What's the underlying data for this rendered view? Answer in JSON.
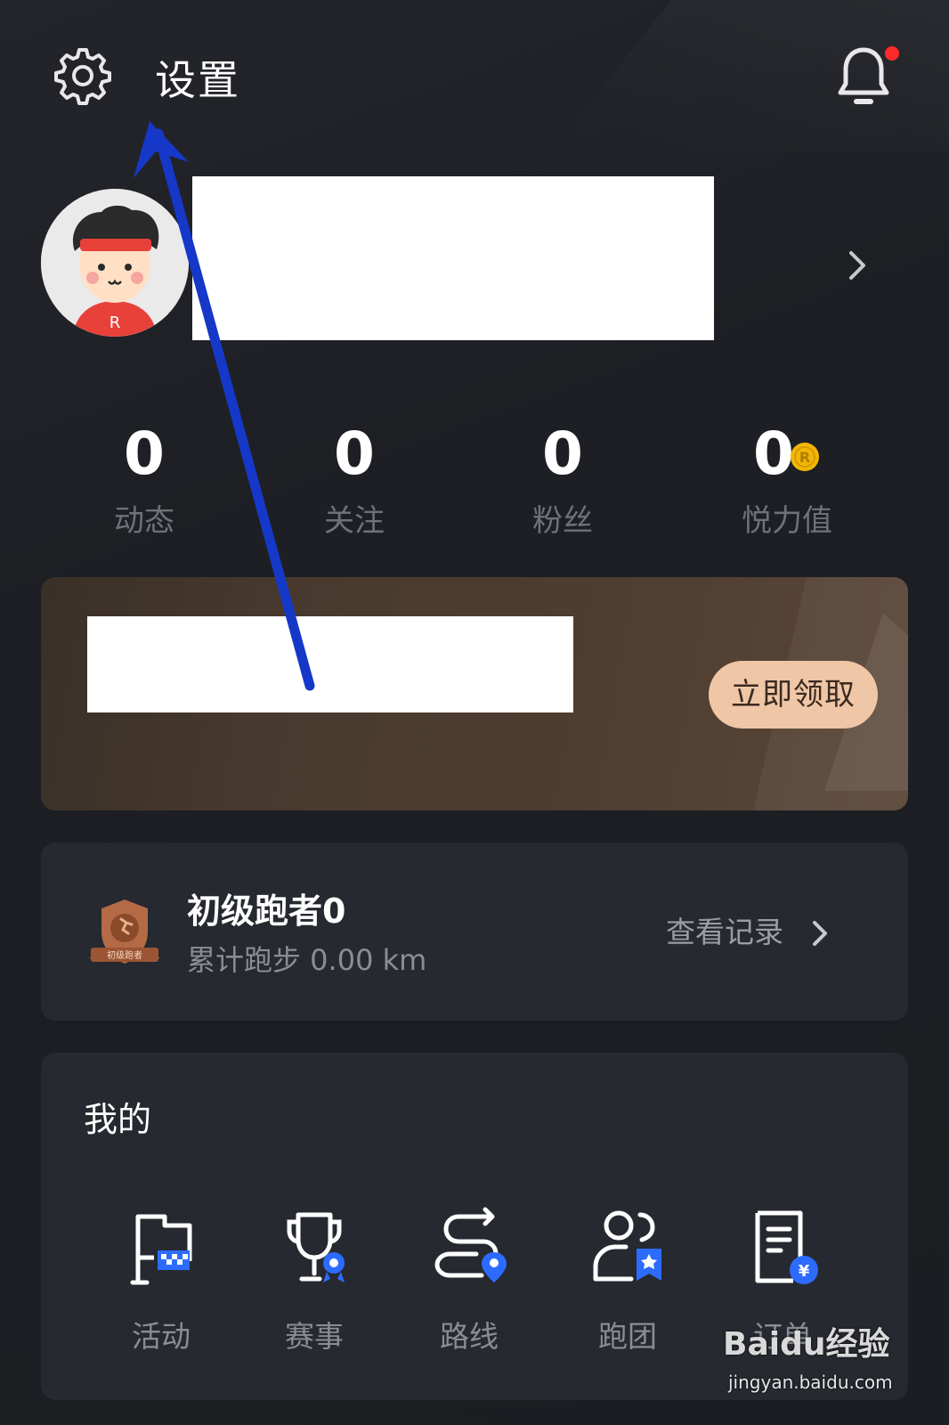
{
  "header": {
    "title": "设置",
    "has_notification": true
  },
  "profile": {
    "name_redacted": true
  },
  "stats": [
    {
      "value": "0",
      "label": "动态"
    },
    {
      "value": "0",
      "label": "关注"
    },
    {
      "value": "0",
      "label": "粉丝"
    },
    {
      "value": "0",
      "label": "悦力值"
    }
  ],
  "promo": {
    "button_label": "立即领取"
  },
  "runner": {
    "title": "初级跑者0",
    "distance_text": "累计跑步 0.00 km",
    "view_records_label": "查看记录",
    "medal_text": "初级跑者"
  },
  "mine": {
    "title": "我的",
    "items": [
      {
        "label": "活动",
        "icon": "activity-flag-icon"
      },
      {
        "label": "赛事",
        "icon": "trophy-icon"
      },
      {
        "label": "路线",
        "icon": "route-icon"
      },
      {
        "label": "跑团",
        "icon": "run-group-icon"
      },
      {
        "label": "订单",
        "icon": "order-icon"
      }
    ]
  },
  "colors": {
    "background": "#1c1e23",
    "card": "#262930",
    "accent_blue": "#2d6bff",
    "claim_button": "#efc6a6",
    "notification_dot": "#ff2a2a",
    "annotation_arrow": "#1538c8"
  },
  "watermark": {
    "brand": "Baidu经验",
    "url": "jingyan.baidu.com"
  }
}
